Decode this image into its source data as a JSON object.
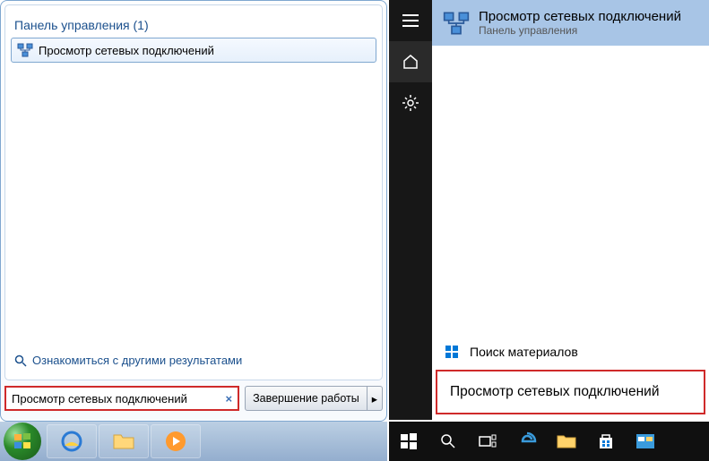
{
  "win7": {
    "header": "Панель управления (1)",
    "result_label": "Просмотр сетевых подключений",
    "more_results": "Ознакомиться с другими результатами",
    "search_text": "Просмотр сетевых подключений",
    "shutdown_label": "Завершение работы"
  },
  "win10": {
    "title": "Просмотр сетевых подключений",
    "subtitle": "Панель управления",
    "materials_label": "Поиск материалов",
    "result_label": "Просмотр сетевых подключений"
  }
}
